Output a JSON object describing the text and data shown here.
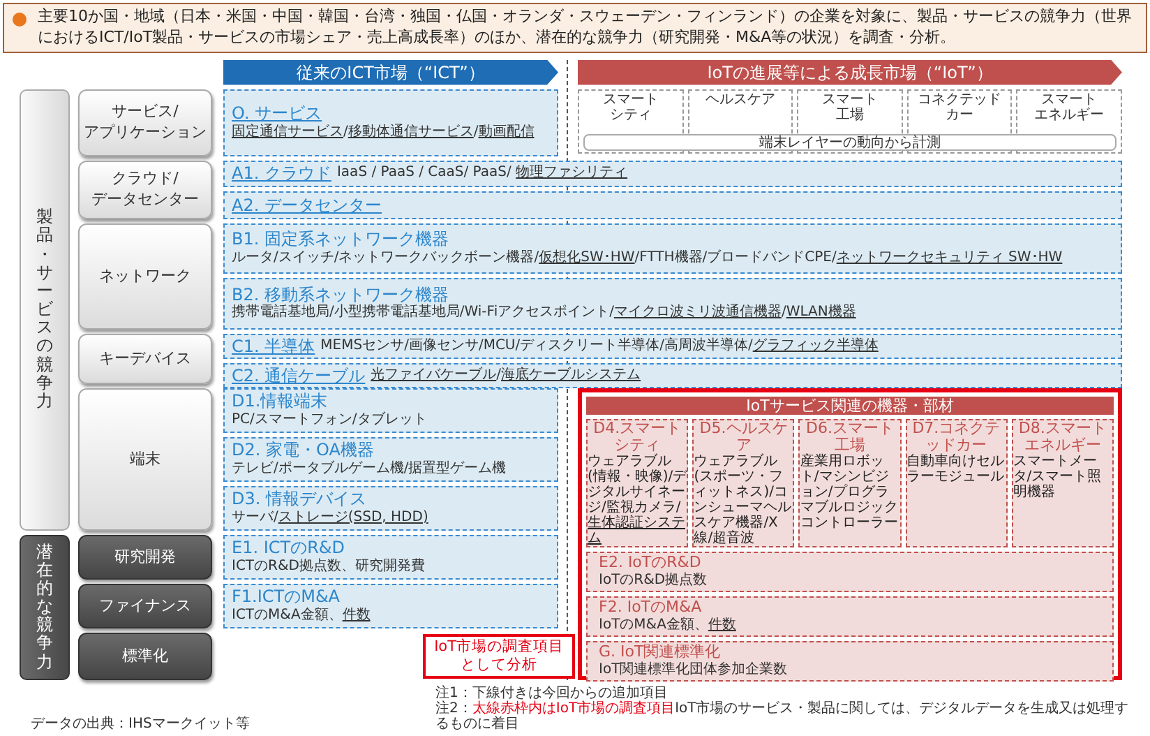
{
  "banner": {
    "text": "主要10か国・地域（日本・米国・中国・韓国・台湾・独国・仏国・オランダ・スウェーデン・フィンランド）の企業を対象に、製品・サービスの競争力（世界におけるICT/IoT製品・サービスの市場シェア・売上高成長率）のほか、潜在的な競争力（研究開発・M&A等の状況）を調査・分析。"
  },
  "market_headers": [
    {
      "label": "従来のICT市場（“ICT”）",
      "kind": "ict"
    },
    {
      "label": "IoTの進展等による成長市場（“IoT”）",
      "kind": "iot"
    }
  ],
  "groups": [
    {
      "label": "製品・サービスの競争力",
      "kind": "product"
    },
    {
      "label": "潜在的な競争力",
      "kind": "potential"
    }
  ],
  "categories": [
    {
      "label": "サービス/\nアプリケーション",
      "kind": "product",
      "boxes": [
        {
          "kind": "stacked",
          "title": "O. サービス",
          "title_underlined": true,
          "detail": [
            {
              "text": "固定通信サービス",
              "underlined": true
            },
            {
              "text": "/",
              "underlined": false
            },
            {
              "text": "移動体通信サービス",
              "underlined": true
            },
            {
              "text": "/",
              "underlined": false
            },
            {
              "text": "動画配信",
              "underlined": true
            }
          ]
        }
      ]
    },
    {
      "label": "クラウド/\nデータセンター",
      "kind": "product",
      "shared_boxes": [
        {
          "kind": "inline",
          "title": "A1. クラウド",
          "title_underlined": true,
          "detail": [
            {
              "text": "IaaS / PaaS / CaaS/ PaaS/ ",
              "underlined": false
            },
            {
              "text": "物理ファシリティ",
              "underlined": true
            }
          ]
        },
        {
          "kind": "inline",
          "title": "A2. データセンター",
          "title_underlined": true
        }
      ]
    },
    {
      "label": "ネットワーク",
      "kind": "product",
      "shared_boxes": [
        {
          "kind": "stacked",
          "title": "B1. 固定系ネットワーク機器",
          "title_underlined": false,
          "detail": [
            {
              "text": "ルータ/スイッチ/ネットワークバックボーン機器/",
              "underlined": false
            },
            {
              "text": "仮想化SW･HW",
              "underlined": true
            },
            {
              "text": "/FTTH機器/ブロードバンドCPE/",
              "underlined": false
            },
            {
              "text": "ネットワークセキュリティ SW･HW",
              "underlined": true
            }
          ]
        },
        {
          "kind": "stacked",
          "title": "B2. 移動系ネットワーク機器",
          "title_underlined": false,
          "detail": [
            {
              "text": "携帯電話基地局/小型携帯電話基地局/Wi-Fiアクセスポイント/",
              "underlined": false
            },
            {
              "text": "マイクロ波ミリ波通信機器",
              "underlined": true
            },
            {
              "text": "/",
              "underlined": false
            },
            {
              "text": "WLAN機器",
              "underlined": true
            }
          ]
        }
      ]
    },
    {
      "label": "キーデバイス",
      "kind": "product",
      "shared_boxes": [
        {
          "kind": "inline",
          "title": "C1. 半導体",
          "title_underlined": true,
          "detail": [
            {
              "text": "MEMSセンサ/画像センサ/MCU/ディスクリート半導体/高周波半導体/",
              "underlined": false
            },
            {
              "text": "グラフィック半導体",
              "underlined": true
            }
          ]
        },
        {
          "kind": "inline",
          "title": "C2. 通信ケーブル",
          "title_underlined": true,
          "detail": [
            {
              "text": "光ファイバケーブル",
              "underlined": true
            },
            {
              "text": "/",
              "underlined": false
            },
            {
              "text": "海底ケーブルシステム",
              "underlined": true
            }
          ]
        }
      ]
    },
    {
      "label": "端末",
      "kind": "product",
      "boxes": [
        {
          "kind": "stacked",
          "title": "D1.情報端末",
          "title_underlined": false,
          "detail": [
            {
              "text": "PC/スマートフォン/タブレット",
              "underlined": false
            }
          ]
        },
        {
          "kind": "stacked",
          "title": "D2. 家電・OA機器",
          "title_underlined": false,
          "detail": [
            {
              "text": "テレビ/ポータブルゲーム機/据置型ゲーム機",
              "underlined": false
            }
          ]
        },
        {
          "kind": "stacked",
          "title": "D3. 情報デバイス",
          "title_underlined": false,
          "detail": [
            {
              "text": "サーバ/",
              "underlined": false
            },
            {
              "text": "ストレージ(SSD, HDD)",
              "underlined": true
            }
          ]
        }
      ]
    },
    {
      "label": "研究開発",
      "kind": "potential",
      "boxes": [
        {
          "kind": "stacked",
          "title": "E1. ICTのR&D",
          "title_underlined": false,
          "detail": [
            {
              "text": "ICTのR&D拠点数、研究開発費",
              "underlined": false
            }
          ]
        }
      ]
    },
    {
      "label": "ファイナンス",
      "kind": "potential",
      "boxes": [
        {
          "kind": "stacked",
          "title": "F1.ICTのM&A",
          "title_underlined": false,
          "detail": [
            {
              "text": "ICTのM&A金額、",
              "underlined": false
            },
            {
              "text": "件数",
              "underlined": true
            }
          ]
        }
      ]
    },
    {
      "label": "標準化",
      "kind": "potential"
    }
  ],
  "iot_markets": {
    "items": [
      [
        "スマート",
        "シティ"
      ],
      [
        "ヘルスケア"
      ],
      [
        "スマート",
        "工場"
      ],
      [
        "コネクテッド",
        "カー"
      ],
      [
        "スマート",
        "エネルギー"
      ]
    ],
    "note": "端末レイヤーの動向から計測"
  },
  "iot_frame": {
    "header": "IoTサービス関連の機器・部材",
    "devices": [
      {
        "title": "D4.スマートシティ",
        "detail": [
          {
            "text": "ウェアラブル(情報・映像)/デジタルサイネージ/監視カメラ/",
            "underlined": false
          },
          {
            "text": "生体認証システム",
            "underlined": true
          }
        ]
      },
      {
        "title": "D5.ヘルスケア",
        "detail": [
          {
            "text": "ウェアラブル(スポーツ・フィットネス)/コンシューマヘルスケア機器/X線/超音波",
            "underlined": false
          }
        ]
      },
      {
        "title": "D6.スマート工場",
        "detail": [
          {
            "text": "産業用ロボット/マシンビジョン/プログラマブルロジックコントローラー",
            "underlined": false
          }
        ]
      },
      {
        "title": "D7.コネクテッドカー",
        "detail": [
          {
            "text": "自動車向けセルラーモジュール",
            "underlined": false
          }
        ]
      },
      {
        "title": "D8.スマートエネルギー",
        "detail": [
          {
            "text": "スマートメータ/スマート照明機器",
            "underlined": false
          }
        ]
      }
    ],
    "boxes": [
      {
        "title": "E2. IoTのR&D",
        "detail": [
          {
            "text": "IoTのR&D拠点数",
            "underlined": false
          }
        ]
      },
      {
        "title": "F2. IoTのM&A",
        "detail": [
          {
            "text": "IoTのM&A金額、",
            "underlined": false
          },
          {
            "text": "件数",
            "underlined": true
          }
        ]
      },
      {
        "title": "G. IoT関連標準化",
        "detail": [
          {
            "text": "IoT関連標準化団体参加企業数",
            "underlined": false
          }
        ]
      }
    ]
  },
  "callout": [
    "IoT市場の調査項目",
    "として分析"
  ],
  "source": "データの出典：IHSマークイット等",
  "notes": [
    [
      {
        "text": "注1：下線付きは今回からの追加項目",
        "emphasis": false
      }
    ],
    [
      {
        "text": "注2：",
        "emphasis": false
      },
      {
        "text": "太線赤枠内はIoT市場の調査項目",
        "emphasis": true
      },
      {
        "text": "IoT市場のサービス・製品に関しては、デジタルデータを生成又は処理するものに着目",
        "emphasis": false
      }
    ]
  ]
}
